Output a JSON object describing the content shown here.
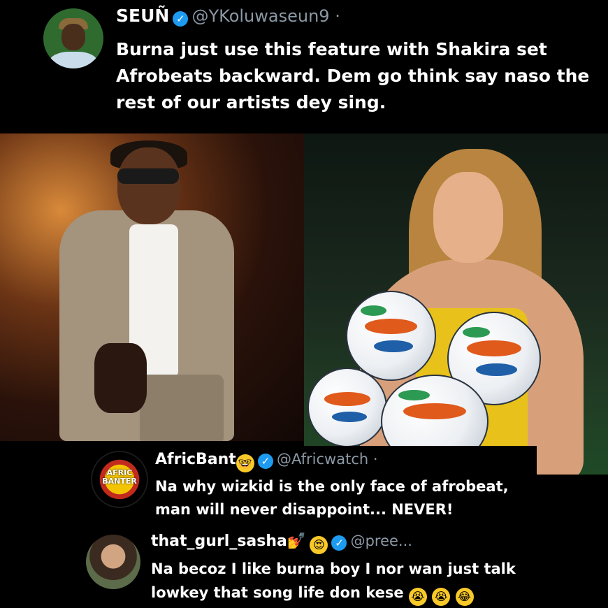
{
  "tweet": {
    "name": "SEUÑ",
    "handle": "@YKoluwaseun9 ·",
    "text": "Burna just use this feature with Shakira set Afrobeats backward. Dem go think say naso the rest of our artists dey sing."
  },
  "replies": [
    {
      "name": "AfricBant",
      "name_emoji": "🤓",
      "handle": "@Africwatch ·",
      "text": "Na why wizkid is the only face of afrobeat, man will never disappoint... NEVER!",
      "avatar_text": "AFRIC BANTER"
    },
    {
      "name": "that_gurl_sasha",
      "name_emojis": [
        "💅",
        "😍"
      ],
      "handle": "@pree...",
      "text": "Na becoz I like burna boy I nor wan just talk lowkey that song life don  kese",
      "trailing_emojis": [
        "😭",
        "😭",
        "😂"
      ]
    }
  ],
  "icons": {
    "verified": "verified-badge-icon",
    "check": "✓"
  },
  "colors": {
    "background": "#000000",
    "verified": "#1d9bf0",
    "handle": "#8b98a5"
  }
}
